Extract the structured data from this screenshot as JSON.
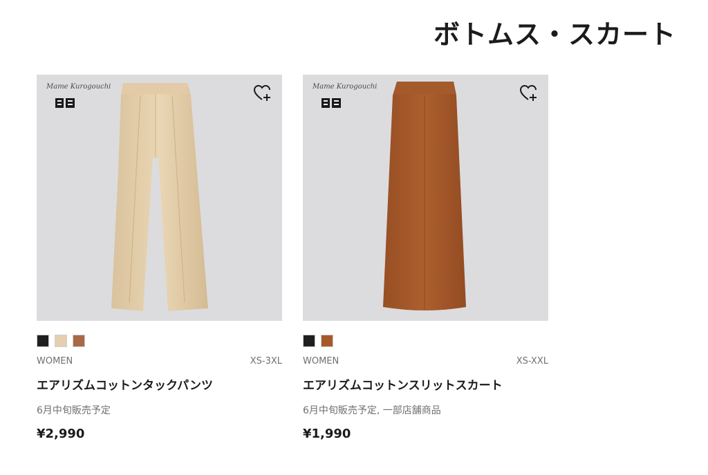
{
  "section": {
    "title": "ボトムス・スカート"
  },
  "brand": {
    "signature": "Mame Kurogouchi",
    "logo_icon": "uniqlo-logo-icon"
  },
  "products": [
    {
      "swatches": [
        "#1f1f1f",
        "#e5cfb0",
        "#a86a46"
      ],
      "category": "WOMEN",
      "size_range": "XS-3XL",
      "name": "エアリズムコットンタックパンツ",
      "note": "6月中旬販売予定",
      "price": "¥2,990",
      "product_color": "#e6d2b0",
      "favorite_icon": "heart-plus-icon"
    },
    {
      "swatches": [
        "#1f1f1f",
        "#a65a2a"
      ],
      "category": "WOMEN",
      "size_range": "XS-XXL",
      "name": "エアリズムコットンスリットスカート",
      "note": "6月中旬販売予定, 一部店舗商品",
      "price": "¥1,990",
      "product_color": "#a65a2a",
      "favorite_icon": "heart-plus-icon"
    }
  ]
}
